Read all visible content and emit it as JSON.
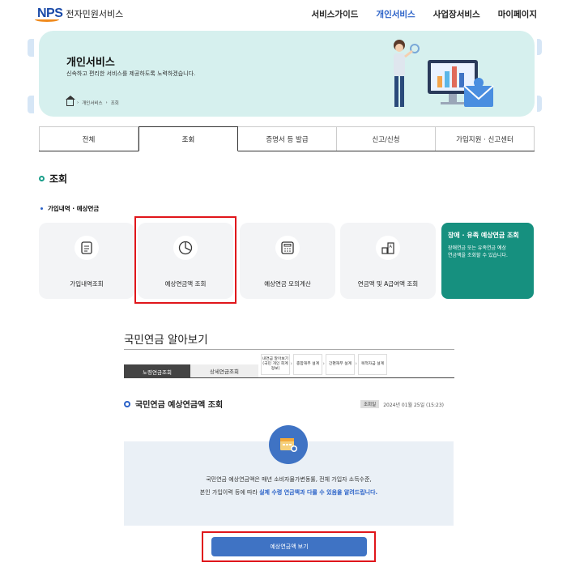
{
  "header": {
    "logo": "NPS",
    "service_name": "전자민원서비스",
    "nav": [
      "서비스가이드",
      "개인서비스",
      "사업장서비스",
      "마이페이지"
    ],
    "nav_active": "개인서비스"
  },
  "banner": {
    "title": "개인서비스",
    "subtitle": "신속하고 편리한 서비스를 제공하도록 노력하겠습니다.",
    "breadcrumb": [
      "개인서비스",
      "조회"
    ]
  },
  "tabs": [
    "전체",
    "조회",
    "증명서 등 발급",
    "신고/신청",
    "가입지원 · 신고센터"
  ],
  "tab_active": "조회",
  "section": {
    "title": "조회",
    "subtitle": "가입내역 · 예상연금"
  },
  "cards": [
    {
      "label": "가입내역조회",
      "icon": "document-icon"
    },
    {
      "label": "예상연금액 조회",
      "icon": "pie-chart-icon"
    },
    {
      "label": "예상연금 모의계산",
      "icon": "calculator-icon"
    },
    {
      "label": "연금액 및 A급여액 조회",
      "icon": "building-chart-icon"
    }
  ],
  "special_card": {
    "title": "장애 · 유족 예상연금 조회",
    "desc_line1": "장애연금 또는 유족연금 예상",
    "desc_line2": "연금액을 조회할 수 있습니다."
  },
  "np": {
    "title": "국민연금 알아보기",
    "tab_a": "노령연금조회",
    "tab_b": "상세연금조회",
    "steps": [
      "내연금 알아보기 (국민 개인 회계정보)",
      "종합재무 설계",
      "간편재무 설계",
      "목적자금 설계"
    ],
    "sub_title": "국민연금 예상연금액 조회",
    "date_tag": "조회일",
    "date": "2024년 01월 25일 (15:23)",
    "info_line1": "국민연금 예상연금액은 매년 소비자물가변동률, 전체 가입자 소득수준,",
    "info_line2_a": "본인 가입이력 등에 따라 ",
    "info_line2_b": "실제 수령 연금액과 다를 수 있음을 알려드립니다.",
    "button": "예상연금액 보기"
  },
  "colors": {
    "brand_blue": "#2b62c8",
    "teal": "#16907f",
    "highlight_red": "#e0161b",
    "button_blue": "#3f73c4"
  }
}
